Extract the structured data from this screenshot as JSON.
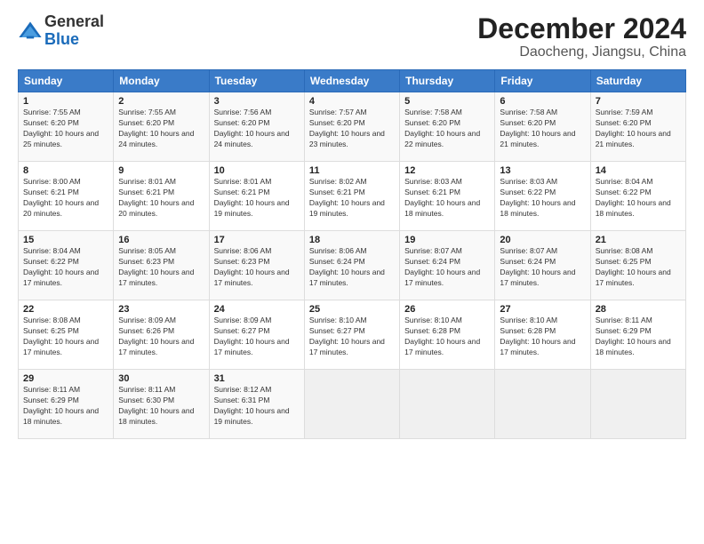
{
  "logo": {
    "general": "General",
    "blue": "Blue"
  },
  "title": "December 2024",
  "location": "Daocheng, Jiangsu, China",
  "days_of_week": [
    "Sunday",
    "Monday",
    "Tuesday",
    "Wednesday",
    "Thursday",
    "Friday",
    "Saturday"
  ],
  "weeks": [
    [
      {
        "day": "1",
        "sunrise": "7:55 AM",
        "sunset": "6:20 PM",
        "daylight": "10 hours and 25 minutes."
      },
      {
        "day": "2",
        "sunrise": "7:55 AM",
        "sunset": "6:20 PM",
        "daylight": "10 hours and 24 minutes."
      },
      {
        "day": "3",
        "sunrise": "7:56 AM",
        "sunset": "6:20 PM",
        "daylight": "10 hours and 24 minutes."
      },
      {
        "day": "4",
        "sunrise": "7:57 AM",
        "sunset": "6:20 PM",
        "daylight": "10 hours and 23 minutes."
      },
      {
        "day": "5",
        "sunrise": "7:58 AM",
        "sunset": "6:20 PM",
        "daylight": "10 hours and 22 minutes."
      },
      {
        "day": "6",
        "sunrise": "7:58 AM",
        "sunset": "6:20 PM",
        "daylight": "10 hours and 21 minutes."
      },
      {
        "day": "7",
        "sunrise": "7:59 AM",
        "sunset": "6:20 PM",
        "daylight": "10 hours and 21 minutes."
      }
    ],
    [
      {
        "day": "8",
        "sunrise": "8:00 AM",
        "sunset": "6:21 PM",
        "daylight": "10 hours and 20 minutes."
      },
      {
        "day": "9",
        "sunrise": "8:01 AM",
        "sunset": "6:21 PM",
        "daylight": "10 hours and 20 minutes."
      },
      {
        "day": "10",
        "sunrise": "8:01 AM",
        "sunset": "6:21 PM",
        "daylight": "10 hours and 19 minutes."
      },
      {
        "day": "11",
        "sunrise": "8:02 AM",
        "sunset": "6:21 PM",
        "daylight": "10 hours and 19 minutes."
      },
      {
        "day": "12",
        "sunrise": "8:03 AM",
        "sunset": "6:21 PM",
        "daylight": "10 hours and 18 minutes."
      },
      {
        "day": "13",
        "sunrise": "8:03 AM",
        "sunset": "6:22 PM",
        "daylight": "10 hours and 18 minutes."
      },
      {
        "day": "14",
        "sunrise": "8:04 AM",
        "sunset": "6:22 PM",
        "daylight": "10 hours and 18 minutes."
      }
    ],
    [
      {
        "day": "15",
        "sunrise": "8:04 AM",
        "sunset": "6:22 PM",
        "daylight": "10 hours and 17 minutes."
      },
      {
        "day": "16",
        "sunrise": "8:05 AM",
        "sunset": "6:23 PM",
        "daylight": "10 hours and 17 minutes."
      },
      {
        "day": "17",
        "sunrise": "8:06 AM",
        "sunset": "6:23 PM",
        "daylight": "10 hours and 17 minutes."
      },
      {
        "day": "18",
        "sunrise": "8:06 AM",
        "sunset": "6:24 PM",
        "daylight": "10 hours and 17 minutes."
      },
      {
        "day": "19",
        "sunrise": "8:07 AM",
        "sunset": "6:24 PM",
        "daylight": "10 hours and 17 minutes."
      },
      {
        "day": "20",
        "sunrise": "8:07 AM",
        "sunset": "6:24 PM",
        "daylight": "10 hours and 17 minutes."
      },
      {
        "day": "21",
        "sunrise": "8:08 AM",
        "sunset": "6:25 PM",
        "daylight": "10 hours and 17 minutes."
      }
    ],
    [
      {
        "day": "22",
        "sunrise": "8:08 AM",
        "sunset": "6:25 PM",
        "daylight": "10 hours and 17 minutes."
      },
      {
        "day": "23",
        "sunrise": "8:09 AM",
        "sunset": "6:26 PM",
        "daylight": "10 hours and 17 minutes."
      },
      {
        "day": "24",
        "sunrise": "8:09 AM",
        "sunset": "6:27 PM",
        "daylight": "10 hours and 17 minutes."
      },
      {
        "day": "25",
        "sunrise": "8:10 AM",
        "sunset": "6:27 PM",
        "daylight": "10 hours and 17 minutes."
      },
      {
        "day": "26",
        "sunrise": "8:10 AM",
        "sunset": "6:28 PM",
        "daylight": "10 hours and 17 minutes."
      },
      {
        "day": "27",
        "sunrise": "8:10 AM",
        "sunset": "6:28 PM",
        "daylight": "10 hours and 17 minutes."
      },
      {
        "day": "28",
        "sunrise": "8:11 AM",
        "sunset": "6:29 PM",
        "daylight": "10 hours and 18 minutes."
      }
    ],
    [
      {
        "day": "29",
        "sunrise": "8:11 AM",
        "sunset": "6:29 PM",
        "daylight": "10 hours and 18 minutes."
      },
      {
        "day": "30",
        "sunrise": "8:11 AM",
        "sunset": "6:30 PM",
        "daylight": "10 hours and 18 minutes."
      },
      {
        "day": "31",
        "sunrise": "8:12 AM",
        "sunset": "6:31 PM",
        "daylight": "10 hours and 19 minutes."
      },
      null,
      null,
      null,
      null
    ]
  ],
  "labels": {
    "sunrise": "Sunrise:",
    "sunset": "Sunset:",
    "daylight": "Daylight:"
  }
}
